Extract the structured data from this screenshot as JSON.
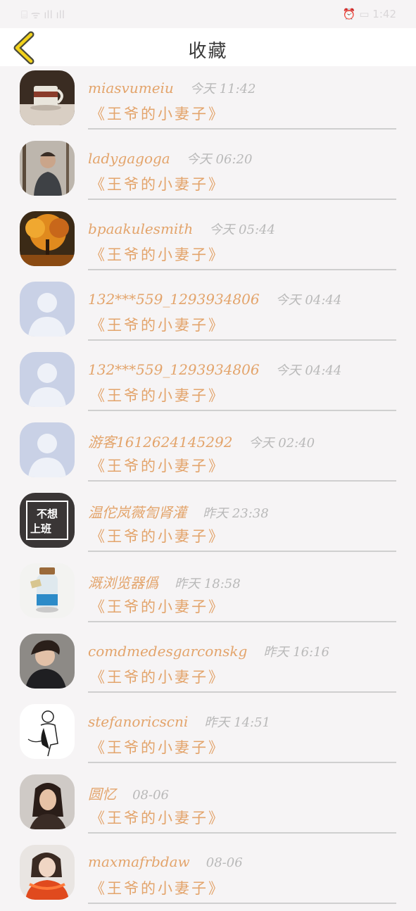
{
  "status_bar": {
    "left_text": "⌸ ᯤ ıll ıll",
    "right_text": "⏰ ▭ 1:42"
  },
  "header": {
    "title": "收藏",
    "back_icon": "chevron-left-icon",
    "accent": "#f2d21b"
  },
  "favorites": [
    {
      "username": "miasvumeiu",
      "time": "今天 11:42",
      "book": "《王爷的小妻子》",
      "avatar": "coffee-mug-photo"
    },
    {
      "username": "ladygagoga",
      "time": "今天 06:20",
      "book": "《王爷的小妻子》",
      "avatar": "man-in-forest-photo"
    },
    {
      "username": "bpaakulesmith",
      "time": "今天 05:44",
      "book": "《王爷的小妻子》",
      "avatar": "autumn-tree-photo"
    },
    {
      "username": "132***559_1293934806",
      "time": "今天 04:44",
      "book": "《王爷的小妻子》",
      "avatar": "default-user-avatar"
    },
    {
      "username": "132***559_1293934806",
      "time": "今天 04:44",
      "book": "《王爷的小妻子》",
      "avatar": "default-user-avatar"
    },
    {
      "username": "游客1612624145292",
      "time": "今天 02:40",
      "book": "《王爷的小妻子》",
      "avatar": "default-user-avatar"
    },
    {
      "username": "温佗岚薇訇肾灌",
      "time": "昨天 23:38",
      "book": "《王爷的小妻子》",
      "avatar": "buxiang-shangban-sign",
      "avatar_text": "不想上班"
    },
    {
      "username": "溉浏览器僞",
      "time": "昨天 18:58",
      "book": "《王爷的小妻子》",
      "avatar": "bottle-photo"
    },
    {
      "username": "comdmedesgarconskg",
      "time": "昨天 16:16",
      "book": "《王爷的小妻子》",
      "avatar": "young-man-photo"
    },
    {
      "username": "stefanoricscni",
      "time": "昨天 14:51",
      "book": "《王爷的小妻子》",
      "avatar": "sketch-figure"
    },
    {
      "username": "圆忆",
      "time": "08-06",
      "book": "《王爷的小妻子》",
      "avatar": "woman-portrait-photo"
    },
    {
      "username": "maxmafrbdaw",
      "time": "08-06",
      "book": "《王爷的小妻子》",
      "avatar": "girl-red-scarf-photo"
    }
  ]
}
